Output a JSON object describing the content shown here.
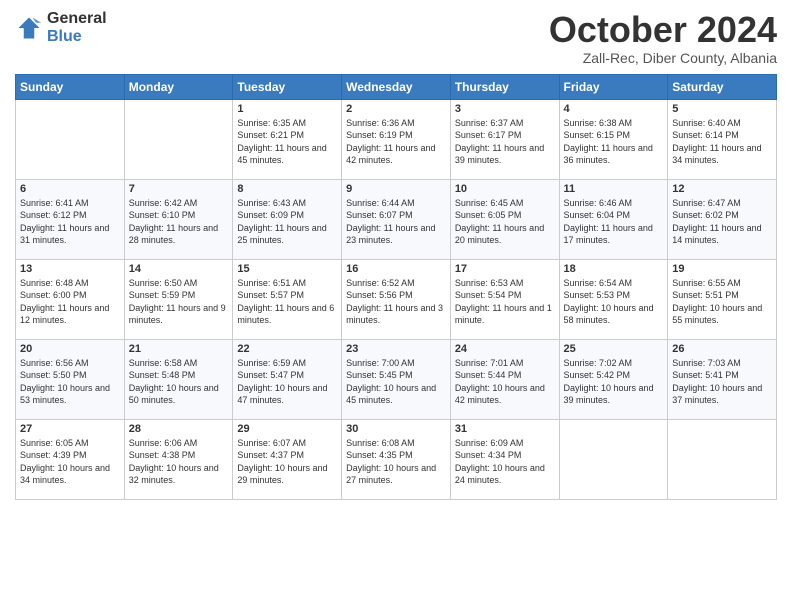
{
  "logo": {
    "general": "General",
    "blue": "Blue"
  },
  "header": {
    "month": "October 2024",
    "location": "Zall-Rec, Diber County, Albania"
  },
  "weekdays": [
    "Sunday",
    "Monday",
    "Tuesday",
    "Wednesday",
    "Thursday",
    "Friday",
    "Saturday"
  ],
  "weeks": [
    [
      null,
      null,
      {
        "day": 1,
        "sunrise": "6:35 AM",
        "sunset": "6:21 PM",
        "daylight": "11 hours and 45 minutes."
      },
      {
        "day": 2,
        "sunrise": "6:36 AM",
        "sunset": "6:19 PM",
        "daylight": "11 hours and 42 minutes."
      },
      {
        "day": 3,
        "sunrise": "6:37 AM",
        "sunset": "6:17 PM",
        "daylight": "11 hours and 39 minutes."
      },
      {
        "day": 4,
        "sunrise": "6:38 AM",
        "sunset": "6:15 PM",
        "daylight": "11 hours and 36 minutes."
      },
      {
        "day": 5,
        "sunrise": "6:40 AM",
        "sunset": "6:14 PM",
        "daylight": "11 hours and 34 minutes."
      }
    ],
    [
      {
        "day": 6,
        "sunrise": "6:41 AM",
        "sunset": "6:12 PM",
        "daylight": "11 hours and 31 minutes."
      },
      {
        "day": 7,
        "sunrise": "6:42 AM",
        "sunset": "6:10 PM",
        "daylight": "11 hours and 28 minutes."
      },
      {
        "day": 8,
        "sunrise": "6:43 AM",
        "sunset": "6:09 PM",
        "daylight": "11 hours and 25 minutes."
      },
      {
        "day": 9,
        "sunrise": "6:44 AM",
        "sunset": "6:07 PM",
        "daylight": "11 hours and 23 minutes."
      },
      {
        "day": 10,
        "sunrise": "6:45 AM",
        "sunset": "6:05 PM",
        "daylight": "11 hours and 20 minutes."
      },
      {
        "day": 11,
        "sunrise": "6:46 AM",
        "sunset": "6:04 PM",
        "daylight": "11 hours and 17 minutes."
      },
      {
        "day": 12,
        "sunrise": "6:47 AM",
        "sunset": "6:02 PM",
        "daylight": "11 hours and 14 minutes."
      }
    ],
    [
      {
        "day": 13,
        "sunrise": "6:48 AM",
        "sunset": "6:00 PM",
        "daylight": "11 hours and 12 minutes."
      },
      {
        "day": 14,
        "sunrise": "6:50 AM",
        "sunset": "5:59 PM",
        "daylight": "11 hours and 9 minutes."
      },
      {
        "day": 15,
        "sunrise": "6:51 AM",
        "sunset": "5:57 PM",
        "daylight": "11 hours and 6 minutes."
      },
      {
        "day": 16,
        "sunrise": "6:52 AM",
        "sunset": "5:56 PM",
        "daylight": "11 hours and 3 minutes."
      },
      {
        "day": 17,
        "sunrise": "6:53 AM",
        "sunset": "5:54 PM",
        "daylight": "11 hours and 1 minute."
      },
      {
        "day": 18,
        "sunrise": "6:54 AM",
        "sunset": "5:53 PM",
        "daylight": "10 hours and 58 minutes."
      },
      {
        "day": 19,
        "sunrise": "6:55 AM",
        "sunset": "5:51 PM",
        "daylight": "10 hours and 55 minutes."
      }
    ],
    [
      {
        "day": 20,
        "sunrise": "6:56 AM",
        "sunset": "5:50 PM",
        "daylight": "10 hours and 53 minutes."
      },
      {
        "day": 21,
        "sunrise": "6:58 AM",
        "sunset": "5:48 PM",
        "daylight": "10 hours and 50 minutes."
      },
      {
        "day": 22,
        "sunrise": "6:59 AM",
        "sunset": "5:47 PM",
        "daylight": "10 hours and 47 minutes."
      },
      {
        "day": 23,
        "sunrise": "7:00 AM",
        "sunset": "5:45 PM",
        "daylight": "10 hours and 45 minutes."
      },
      {
        "day": 24,
        "sunrise": "7:01 AM",
        "sunset": "5:44 PM",
        "daylight": "10 hours and 42 minutes."
      },
      {
        "day": 25,
        "sunrise": "7:02 AM",
        "sunset": "5:42 PM",
        "daylight": "10 hours and 39 minutes."
      },
      {
        "day": 26,
        "sunrise": "7:03 AM",
        "sunset": "5:41 PM",
        "daylight": "10 hours and 37 minutes."
      }
    ],
    [
      {
        "day": 27,
        "sunrise": "6:05 AM",
        "sunset": "4:39 PM",
        "daylight": "10 hours and 34 minutes."
      },
      {
        "day": 28,
        "sunrise": "6:06 AM",
        "sunset": "4:38 PM",
        "daylight": "10 hours and 32 minutes."
      },
      {
        "day": 29,
        "sunrise": "6:07 AM",
        "sunset": "4:37 PM",
        "daylight": "10 hours and 29 minutes."
      },
      {
        "day": 30,
        "sunrise": "6:08 AM",
        "sunset": "4:35 PM",
        "daylight": "10 hours and 27 minutes."
      },
      {
        "day": 31,
        "sunrise": "6:09 AM",
        "sunset": "4:34 PM",
        "daylight": "10 hours and 24 minutes."
      },
      null,
      null
    ]
  ],
  "labels": {
    "sunrise": "Sunrise:",
    "sunset": "Sunset:",
    "daylight": "Daylight:"
  }
}
